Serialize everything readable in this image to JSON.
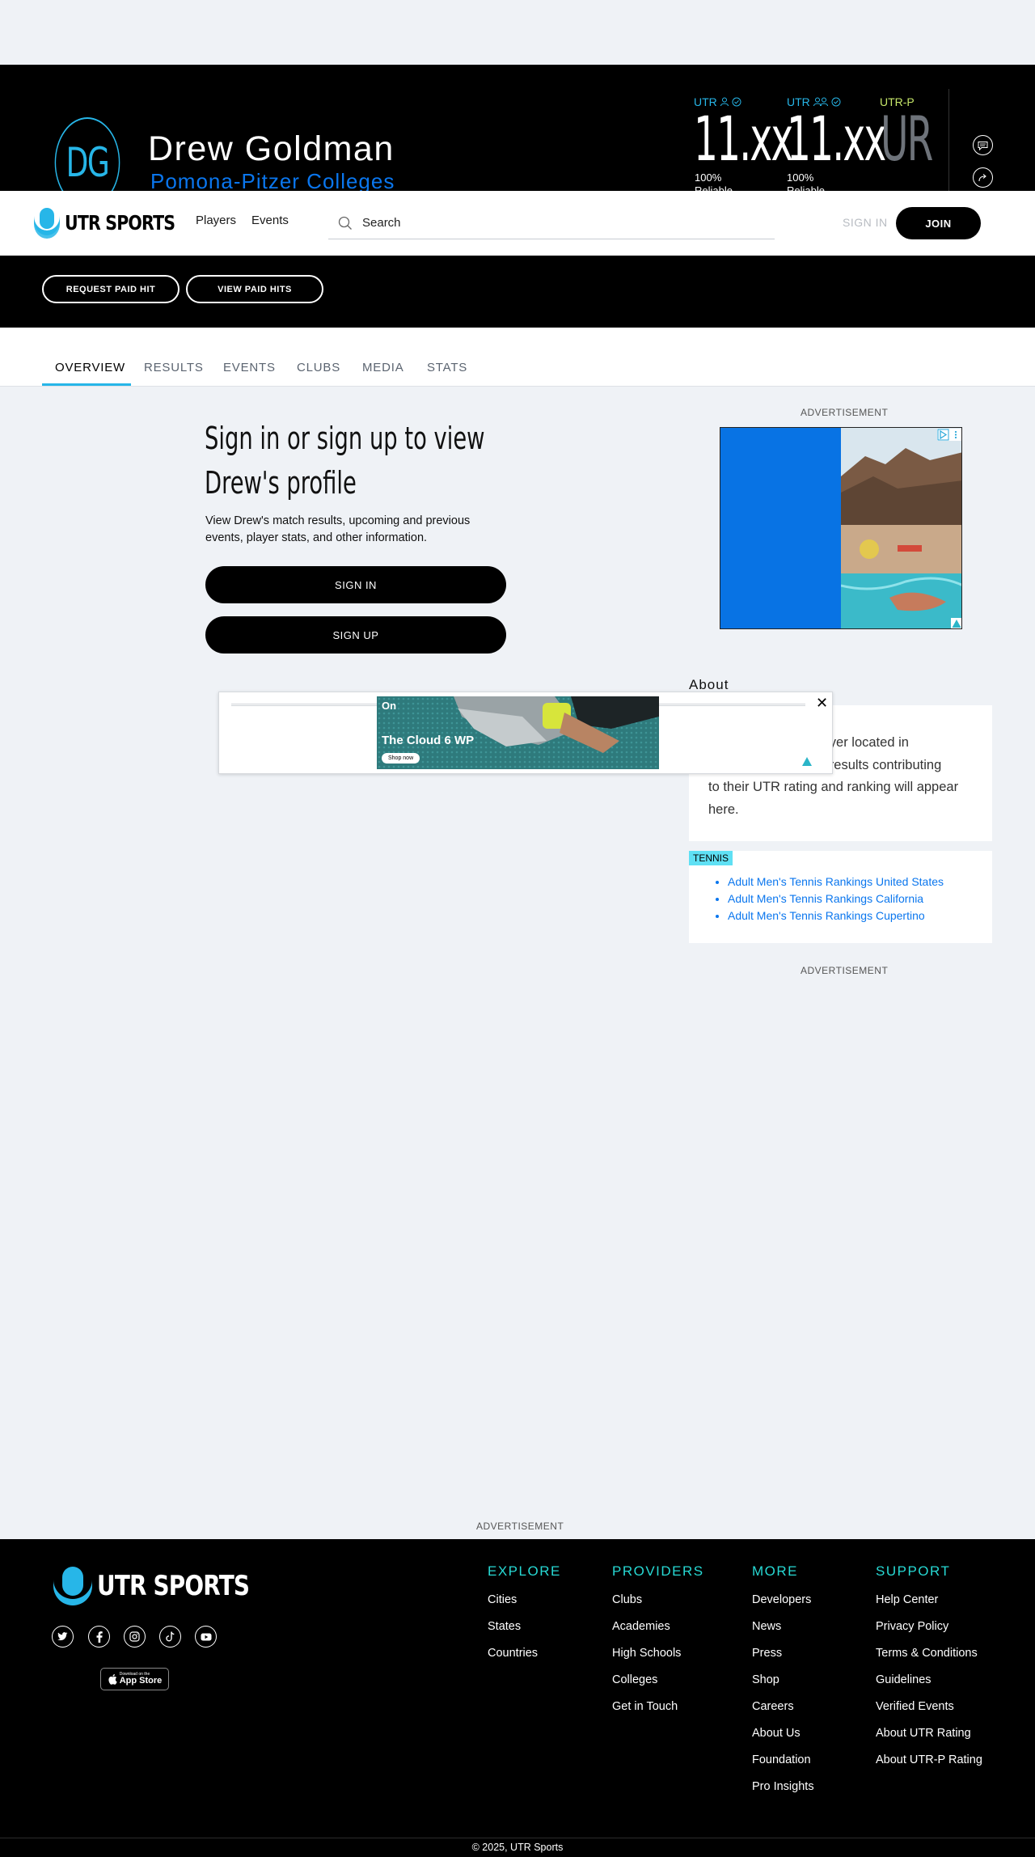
{
  "profile": {
    "initials": "DG",
    "name": "Drew Goldman",
    "college": "Pomona-Pitzer Colleges",
    "ratings": [
      {
        "label": "UTR",
        "value": "11.xx",
        "reliability": "100%",
        "reliability_label": "Reliable",
        "label_color": "#27b6e8"
      },
      {
        "label": "UTR",
        "value": "11.xx",
        "reliability": "100%",
        "reliability_label": "Reliable",
        "label_color": "#27b6e8"
      },
      {
        "label": "UTR-P",
        "value": "UR",
        "label_color": "#c7e86a"
      }
    ]
  },
  "navbar": {
    "logo_text": "UTR SPORTS",
    "links": [
      "Players",
      "Events"
    ],
    "search_placeholder": "Search",
    "sign_in": "SIGN IN",
    "join": "JOIN"
  },
  "actions": {
    "request_paid_hit": "REQUEST PAID HIT",
    "view_paid_hits": "VIEW PAID HITS"
  },
  "tabs": [
    "OVERVIEW",
    "RESULTS",
    "EVENTS",
    "CLUBS",
    "MEDIA",
    "STATS"
  ],
  "prompt": {
    "title": "Sign in or sign up to view Drew's profile",
    "description": "View Drew's match results, upcoming and previous events, player stats, and other information.",
    "sign_in": "SIGN IN",
    "sign_up": "SIGN UP"
  },
  "ads": {
    "label": "ADVERTISEMENT",
    "banner_title": "The Cloud 6 WP",
    "banner_cta": "Shop now",
    "banner_brand": "On"
  },
  "about": {
    "title": "About",
    "text": "Drew Goldman is a player located in Cupertino, CA. Match results contributing to their UTR rating and ranking will appear here.",
    "text_visible_1": "a player located in",
    "text_visible_2": "atch results contributing",
    "text_visible_3": "to their UTR rating and ranking will appear",
    "text_visible_4": "here."
  },
  "rankings": {
    "badge": "TENNIS",
    "links": [
      "Adult Men's Tennis Rankings United States",
      "Adult Men's Tennis Rankings California",
      "Adult Men's Tennis Rankings Cupertino"
    ]
  },
  "footer": {
    "logo_text": "UTR SPORTS",
    "app_store_small": "Download on the",
    "app_store": "App Store",
    "columns": [
      {
        "title": "EXPLORE",
        "links": [
          "Cities",
          "States",
          "Countries"
        ]
      },
      {
        "title": "PROVIDERS",
        "links": [
          "Clubs",
          "Academies",
          "High Schools",
          "Colleges",
          "Get in Touch"
        ]
      },
      {
        "title": "MORE",
        "links": [
          "Developers",
          "News",
          "Press",
          "Shop",
          "Careers",
          "About Us",
          "Foundation",
          "Pro Insights"
        ]
      },
      {
        "title": "SUPPORT",
        "links": [
          "Help Center",
          "Privacy Policy",
          "Terms & Conditions",
          "Guidelines",
          "Verified Events",
          "About UTR Rating",
          "About UTR-P Rating"
        ]
      }
    ],
    "copyright": "© 2025, UTR Sports"
  },
  "colors": {
    "accent": "#27b6e8",
    "link": "#0a76ee",
    "footer_heading": "#27d9d4",
    "background": "#eff2f6"
  }
}
